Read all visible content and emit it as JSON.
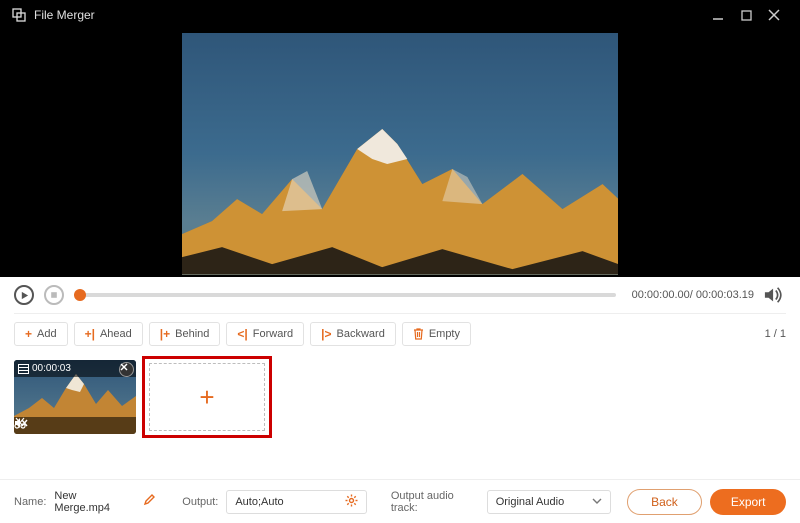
{
  "titlebar": {
    "title": "File Merger"
  },
  "playback": {
    "current_time": "00:00:00.00",
    "total_time": "00:00:03.19"
  },
  "toolbar": {
    "add": "Add",
    "ahead": "Ahead",
    "behind": "Behind",
    "forward": "Forward",
    "backward": "Backward",
    "empty": "Empty",
    "page_current": "1",
    "page_total": "1"
  },
  "clips": {
    "items": [
      {
        "duration": "00:00:03"
      }
    ]
  },
  "bottom": {
    "name_label": "Name:",
    "name_value": "New Merge.mp4",
    "output_label": "Output:",
    "output_value": "Auto;Auto",
    "audio_label": "Output audio track:",
    "audio_value": "Original Audio",
    "back_label": "Back",
    "export_label": "Export"
  },
  "colors": {
    "accent": "#e66a1f"
  }
}
